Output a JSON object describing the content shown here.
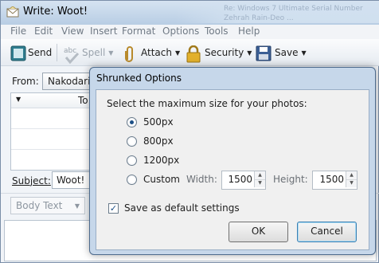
{
  "window": {
    "title": "Write: Woot!",
    "bg_notice_lines": [
      "Re: Windows 7 Ultimate Serial Number",
      "Zehrah Rain-Deo ..."
    ]
  },
  "menu": [
    "File",
    "Edit",
    "View",
    "Insert",
    "Format",
    "Options",
    "Tools",
    "Help"
  ],
  "toolbar": {
    "send": "Send",
    "spell": "Spell",
    "attach": "Attach",
    "security": "Security",
    "save": "Save"
  },
  "compose": {
    "from_label": "From:",
    "from_value": "Nakodari",
    "recipient_type": "To",
    "subject_label": "Subject:",
    "subject_value": "Woot!",
    "body_style": "Body Text"
  },
  "dialog": {
    "title": "Shrunked Options",
    "prompt": "Select the maximum size for your photos:",
    "options": [
      {
        "label": "500px",
        "checked": true
      },
      {
        "label": "800px",
        "checked": false
      },
      {
        "label": "1200px",
        "checked": false
      },
      {
        "label": "Custom",
        "checked": false
      }
    ],
    "width_label": "Width:",
    "width_value": "1500",
    "height_label": "Height:",
    "height_value": "1500",
    "default_label": "Save as default settings",
    "default_checked": true,
    "ok": "OK",
    "cancel": "Cancel"
  },
  "colors": {
    "title_bar": "#c6d7ea",
    "radio_selected": "#1c4f86",
    "dialog_body": "#f0f0f0"
  }
}
